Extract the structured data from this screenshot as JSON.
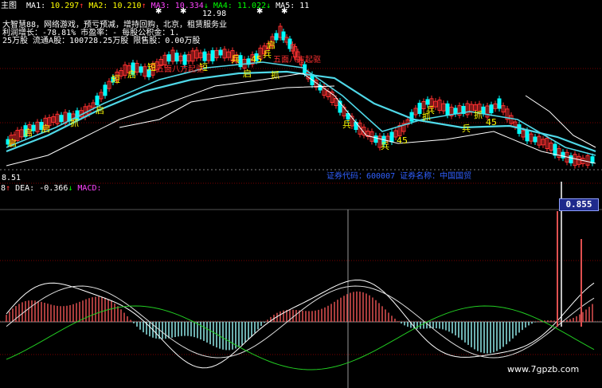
{
  "indicator_bar": {
    "prefix": "主图",
    "items": [
      {
        "label": "MA1:",
        "value": "10.297",
        "arrow": "↑",
        "color": "#ffffff",
        "vcolor": "#ffff00"
      },
      {
        "label": "MA2:",
        "value": "10.210",
        "arrow": "↑",
        "color": "#ffff00",
        "vcolor": "#ffff00"
      },
      {
        "label": "MA3:",
        "value": "10.334",
        "arrow": "↓",
        "color": "#ff44ff",
        "vcolor": "#ff44ff"
      },
      {
        "label": "MA4:",
        "value": "11.022",
        "arrow": "↓",
        "color": "#00ff00",
        "vcolor": "#00ff00"
      },
      {
        "label": "MA5:",
        "value": "11",
        "arrow": "",
        "color": "#ffffff",
        "vcolor": "#ffffff"
      }
    ]
  },
  "info_lines": [
    "大智慧88，网络游戏，预亏预减，增持回购，北京，租赁服务业",
    " 利润增长：-78.81%   市盈率：-        每股公积金：1.",
    "25万股   流通A股：100728.25万股   限售股：0.00万股"
  ],
  "price_labels": {
    "high": "12.98",
    "low_left": "8.51",
    "stock_code_row": "证券代码：600007 证券名称：中国国贸"
  },
  "macd_header": {
    "dif_suffix": "8",
    "dif_arrow": "↑",
    "dea_label": "DEA:",
    "dea_value": "-0.366",
    "dea_arrow": "↓",
    "macd_label": "MACD:"
  },
  "value_box": "0.855",
  "watermark": "www.7gpzb.com",
  "signal_labels": [
    "启",
    "启",
    "启",
    "抓",
    "启",
    "短",
    "启",
    "短",
    "短",
    "兵",
    "启",
    "兵",
    "45",
    "启",
    "抓",
    "兵",
    "45",
    "兵",
    "抓",
    "兵",
    "兵",
    "抓",
    "45"
  ],
  "annotations": [
    "五面八方起驱",
    "五面八方起驱"
  ],
  "colors": {
    "background": "#000000",
    "up_candle": "#ff3030",
    "down_candle": "#00ffff",
    "ma_cyan": "#4fd8e8",
    "ma_white": "#ffffff",
    "ma_green": "#22cc22",
    "grid_red": "#7a0000",
    "dotted_blue": "#3050ff"
  },
  "icons": [
    "up-arrow-icon",
    "down-arrow-icon",
    "star-marker-icon"
  ]
}
